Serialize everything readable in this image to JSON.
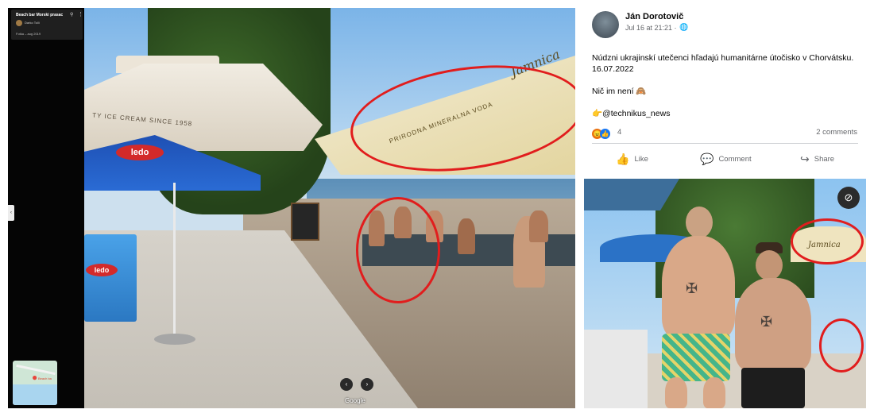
{
  "streetview": {
    "place_name": "Beach bar Morski prasac",
    "author": "Darko Tolli",
    "date": "Fotka – aug 2019",
    "parasol_text": "TY ICE CREAM SINCE 1958",
    "ledo_brand": "ledo",
    "umbrella_text": "PRIRODNA MINERALNA VODA",
    "umbrella_brand": "Jamnica",
    "minimap_label": "Beach ba",
    "google_label": "Google",
    "prev_label": "‹",
    "next_label": "›",
    "handle_label": "‹",
    "colors": {
      "highlight": "#e11d1d",
      "ledo_red": "#d32a2a",
      "ledo_blue": "#1e50b4"
    }
  },
  "post": {
    "author": "Ján Dorotovič",
    "timestamp": "Jul 16 at 21:21 ·",
    "audience_icon": "globe-icon",
    "text_line1": "Núdzni ukrajinskí utečenci hľadajú humanitárne útočisko v Chorvátsku. 16.07.2022",
    "text_line2": "Nič im není 🙈",
    "text_line3": "👉@technikus_news",
    "reaction_count": "4",
    "comments": "2 comments",
    "actions": {
      "like": "Like",
      "comment": "Comment",
      "share": "Share"
    },
    "photo_brand": "Jamnica",
    "colors": {
      "text": "#050505",
      "muted": "#65676b",
      "fb_blue": "#1877f2"
    }
  }
}
